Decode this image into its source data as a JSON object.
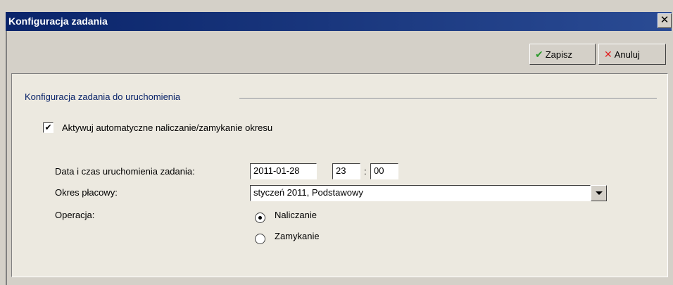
{
  "window": {
    "title": "Konfiguracja zadania",
    "close_label": "✕"
  },
  "toolbar": {
    "save_icon": "check-icon",
    "save_label": "Zapisz",
    "cancel_icon": "x-icon",
    "cancel_label": "Anuluj"
  },
  "group": {
    "title": "Konfiguracja zadania do uruchomienia"
  },
  "auto_checkbox": {
    "checked": true,
    "check_mark": "✔",
    "label": "Aktywuj automatyczne naliczanie/zamykanie okresu"
  },
  "form": {
    "date_label": "Data i czas uruchomienia zadania:",
    "date_value": "2011-01-28",
    "hour_value": "23",
    "time_separator": ":",
    "minute_value": "00",
    "period_label": "Okres płacowy:",
    "period_value": "styczeń 2011, Podstawowy",
    "operation_label": "Operacja:",
    "operations": [
      {
        "label": "Naliczanie",
        "selected": true
      },
      {
        "label": "Zamykanie",
        "selected": false
      }
    ]
  }
}
